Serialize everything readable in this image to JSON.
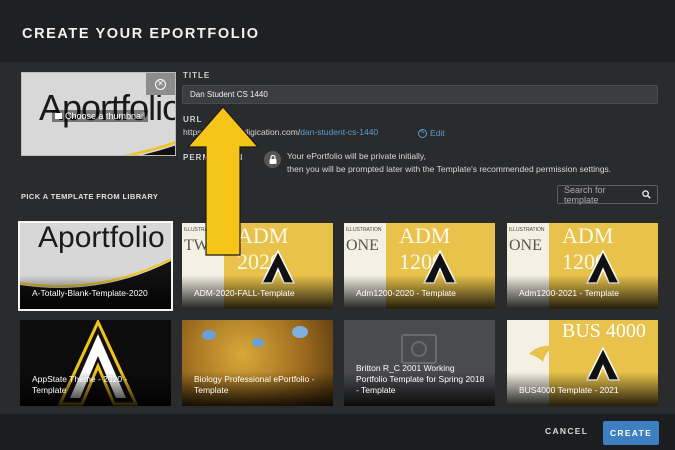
{
  "dialog": {
    "title": "CREATE YOUR EPORTFOLIO"
  },
  "thumbnail": {
    "brand_text": "Aportfolio",
    "choose_label": "Choose a thumbnail"
  },
  "form": {
    "title_label": "TITLE",
    "title_value": "Dan Student CS 1440",
    "url_label": "URL",
    "url_base": "https://appstate.digication.com/",
    "url_slug": "dan-student-cs-1440",
    "edit_label": "Edit",
    "permission_label": "PERMISSION",
    "permission_line1": "Your ePortfolio will be private initially,",
    "permission_line2": "then you will be prompted later with the Template's recommended permission settings."
  },
  "library": {
    "heading": "PICK A TEMPLATE FROM LIBRARY",
    "search_placeholder": "Search for template",
    "templates": [
      {
        "name": "A-Totally-Blank-Template-2020",
        "selected": true
      },
      {
        "name": "ADM-2020-FALL-Template"
      },
      {
        "name": "Adm1200-2020 - Template"
      },
      {
        "name": "Adm1200-2021 - Template"
      },
      {
        "name": "AppState Theme - 2020 - Template"
      },
      {
        "name": "Biology Professional ePortfolio - Template"
      },
      {
        "name": "Britton R_C 2001 Working Portfolio Template for Spring 2018 - Template"
      },
      {
        "name": "BUS4000 Template - 2021"
      }
    ],
    "card_texts": {
      "blank_brand": "Aportfolio",
      "adm2020_big": "ADM 2020",
      "adm2020_side": "TWO",
      "adm1200_big": "ADM 1200",
      "adm1200_side": "ONE",
      "illustration": "ILLUSTRATION",
      "bus_big": "BUS 4000"
    }
  },
  "footer": {
    "cancel_label": "CANCEL",
    "create_label": "CREATE"
  },
  "colors": {
    "accent": "#3e7fc1",
    "gold": "#f0c419",
    "arrow": "#f5c518"
  }
}
